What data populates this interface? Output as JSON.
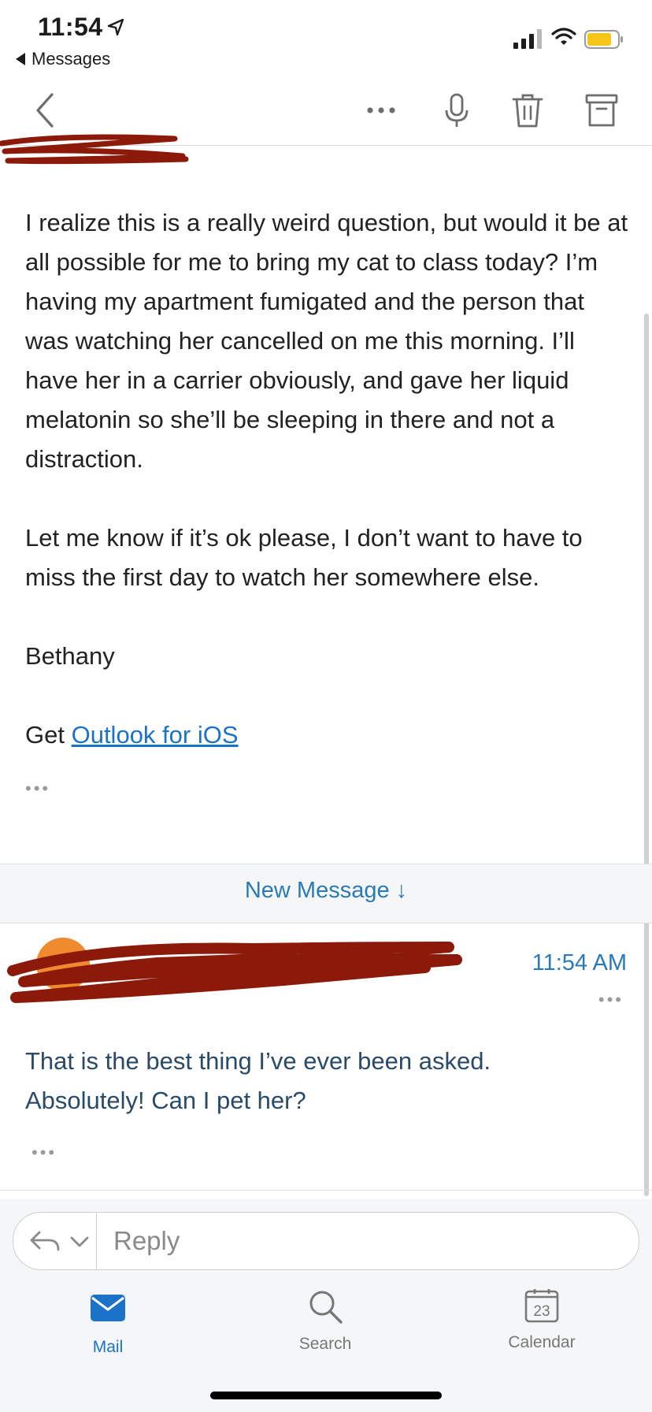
{
  "status_bar": {
    "time": "11:54",
    "back_app": "Messages",
    "icons": [
      "location-arrow-icon",
      "signal-icon",
      "wifi-icon",
      "battery-icon"
    ]
  },
  "toolbar": {
    "icons": [
      "back-chevron-icon",
      "more-icon",
      "microphone-icon",
      "trash-icon",
      "archive-icon"
    ]
  },
  "message": {
    "paragraphs": [
      "I realize this is a really weird question, but would it be at all possible for me to bring my cat to class today? I’m having my apartment fumigated and the person that was watching her cancelled on me this morning. I’ll have her in a carrier obviously, and gave her liquid melatonin so she’ll be sleeping in there and not a distraction.",
      "Let me know if it’s ok please, I don’t want to have to miss the first day to watch her somewhere else.",
      "Bethany"
    ],
    "signature_prefix": "Get ",
    "signature_link": "Outlook for iOS",
    "ellipsis": "•••"
  },
  "new_message_banner": {
    "label": "New Message ↓"
  },
  "reply_message": {
    "time": "11:54 AM",
    "more": "•••",
    "line1": "That is the best thing I’ve ever been asked.",
    "line2": "Absolutely! Can I pet her?",
    "ellipsis": "•••"
  },
  "reply_bar": {
    "placeholder": "Reply"
  },
  "tabs": [
    {
      "label": "Mail",
      "icon": "mail-icon"
    },
    {
      "label": "Search",
      "icon": "search-icon"
    },
    {
      "label": "Calendar",
      "icon": "calendar-icon",
      "badge": "23"
    }
  ],
  "colors": {
    "accent": "#1a73c8",
    "redaction": "#8b1a0a"
  }
}
